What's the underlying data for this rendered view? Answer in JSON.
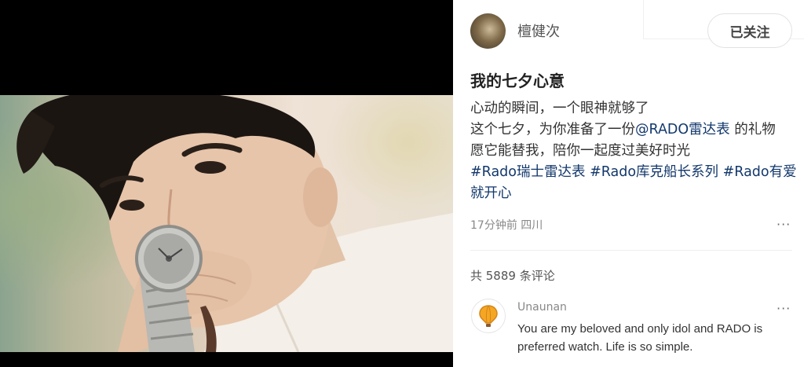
{
  "post": {
    "author": "檀健次",
    "follow_label": "已关注",
    "title": "我的七夕心意",
    "body": {
      "line1": "心动的瞬间，一个眼神就够了",
      "line2_a": "这个七夕，为你准备了一份",
      "line2_mention": "@RADO雷达表",
      "line2_b": " 的礼物",
      "line3": "愿它能替我，陪你一起度过美好时光",
      "tag1": "#Rado瑞士雷达表",
      "tag2": "#Rado库克船长系列",
      "tag3": "#Rado有爱",
      "tag3_cont": "就开心"
    },
    "meta": "17分钟前 四川",
    "more_glyph": "···"
  },
  "comments": {
    "count_label": "共 5889 条评论",
    "items": [
      {
        "user": "Unaunan",
        "text": "You are my beloved and only idol and RADO is preferred watch. Life is so simple.",
        "avatar_icon": "hot-air-balloon-icon",
        "more_glyph": "···"
      }
    ]
  },
  "colors": {
    "link": "#13386c",
    "media_background": "#000000",
    "balloon": "#f5a623"
  },
  "icons": [
    "author-avatar",
    "more-options-icon",
    "hot-air-balloon-icon"
  ]
}
